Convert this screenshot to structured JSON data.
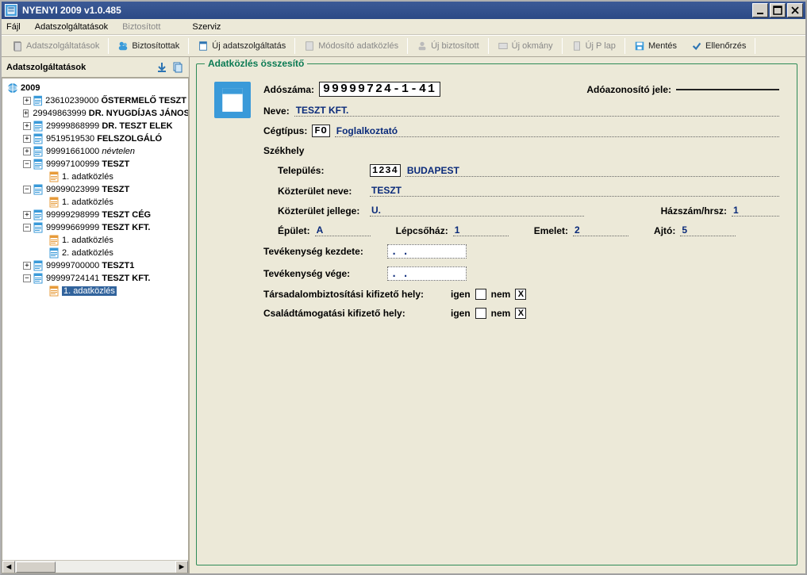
{
  "window": {
    "title": "NYENYI 2009   v1.0.485"
  },
  "menu": {
    "fajl": "Fájl",
    "adatszolg": "Adatszolgáltatások",
    "biztositott": "Biztosított",
    "szerviz": "Szerviz"
  },
  "toolbar": {
    "adatszolg": "Adatszolgáltatások",
    "biztositottak": "Biztosítottak",
    "uj_adatszolgaltatas": "Új adatszolgáltatás",
    "modosito": "Módosító adatközlés",
    "uj_biztositott": "Új biztosított",
    "uj_okmany": "Új okmány",
    "uj_p_lap": "Új P lap",
    "mentes": "Mentés",
    "ellenorzes": "Ellenőrzés"
  },
  "sidebar": {
    "title": "Adatszolgáltatások",
    "year": "2009",
    "items": [
      {
        "exp": "+",
        "code": "23610239000",
        "name": "ŐSTERMELŐ TESZT",
        "icon": "blue"
      },
      {
        "exp": "+",
        "code": "29949863999",
        "name": "DR. NYUGDÍJAS JÁNOS",
        "icon": "blue"
      },
      {
        "exp": "+",
        "code": "29999868999",
        "name": "DR. TESZT ELEK",
        "icon": "blue"
      },
      {
        "exp": "+",
        "code": "9519519530",
        "name": "FELSZOLGÁLÓ",
        "icon": "blue"
      },
      {
        "exp": "+",
        "code": "99991661000",
        "name": "névtelen",
        "icon": "blue",
        "italic": true
      },
      {
        "exp": "-",
        "code": "99997100999",
        "name": "TESZT",
        "icon": "blue",
        "children": [
          {
            "label": "1. adatközlés",
            "icon": "orange"
          }
        ]
      },
      {
        "exp": "-",
        "code": "99999023999",
        "name": "TESZT",
        "icon": "blue",
        "children": [
          {
            "label": "1. adatközlés",
            "icon": "orange"
          }
        ]
      },
      {
        "exp": "+",
        "code": "99999298999",
        "name": "TESZT CÉG",
        "icon": "blue"
      },
      {
        "exp": "-",
        "code": "99999669999",
        "name": "TESZT KFT.",
        "icon": "blue",
        "children": [
          {
            "label": "1. adatközlés",
            "icon": "orange"
          },
          {
            "label": "2. adatközlés",
            "icon": "blue"
          }
        ]
      },
      {
        "exp": "+",
        "code": "99999700000",
        "name": "TESZT1",
        "icon": "blue"
      },
      {
        "exp": "-",
        "code": "99999724141",
        "name": "TESZT KFT.",
        "icon": "blue",
        "children": [
          {
            "label": "1. adatközlés",
            "icon": "orange",
            "selected": true
          }
        ]
      }
    ]
  },
  "form": {
    "legend": "Adatközlés összesítő",
    "adoszama_lbl": "Adószáma:",
    "adoszama": "99999724-1-41",
    "adoazonosito_lbl": "Adóazonosító jele:",
    "adoazonosito": "",
    "neve_lbl": "Neve:",
    "neve": "TESZT KFT.",
    "cegtipus_lbl": "Cégtípus:",
    "cegtipus_code": "FO",
    "cegtipus_name": "Foglalkoztató",
    "szekhely_lbl": "Székhely",
    "telepules_lbl": "Település:",
    "telepules_code": "1234",
    "telepules_name": "BUDAPEST",
    "kozterulet_neve_lbl": "Közterület neve:",
    "kozterulet_neve": "TESZT",
    "kozterulet_jellege_lbl": "Közterület jellege:",
    "kozterulet_jellege": "U.",
    "hazszam_lbl": "Házszám/hrsz:",
    "hazszam": "1",
    "epulet_lbl": "Épület:",
    "epulet": "A",
    "lepcsohaz_lbl": "Lépcsőház:",
    "lepcsohaz": "1",
    "emelet_lbl": "Emelet:",
    "emelet": "2",
    "ajto_lbl": "Ajtó:",
    "ajto": "5",
    "tev_kezdete_lbl": "Tevékenység kezdete:",
    "tev_kezdete": "    .    .    ",
    "tev_vege_lbl": "Tevékenység vége:",
    "tev_vege": "    .    .    ",
    "tb_lbl": "Társadalombiztosítási kifizető hely:",
    "csalad_lbl": "Családtámogatási kifizető hely:",
    "igen": "igen",
    "nem": "nem",
    "tb_val": "nem",
    "csalad_val": "nem"
  }
}
